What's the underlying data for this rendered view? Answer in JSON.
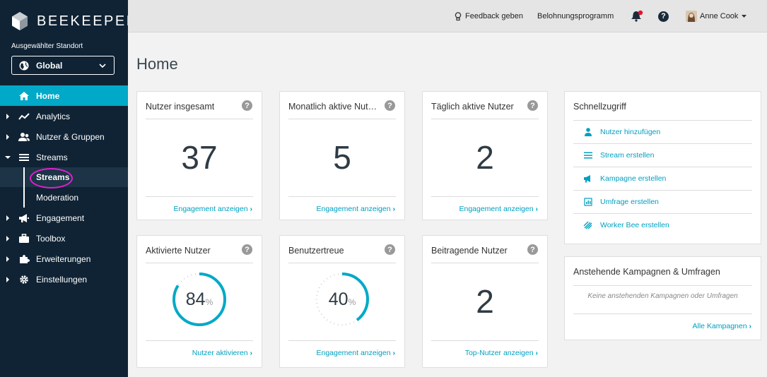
{
  "brand": {
    "name": "BEEKEEPER"
  },
  "location": {
    "label": "Ausgewählter Standort",
    "selected": "Global"
  },
  "nav": {
    "home": "Home",
    "analytics": "Analytics",
    "users": "Nutzer & Gruppen",
    "streams": "Streams",
    "streams_sub": "Streams",
    "moderation": "Moderation",
    "engagement": "Engagement",
    "toolbox": "Toolbox",
    "extensions": "Erweiterungen",
    "settings": "Einstellungen"
  },
  "topbar": {
    "feedback": "Feedback geben",
    "rewards": "Belohnungsprogramm",
    "help": "?",
    "user": "Anne Cook"
  },
  "page": {
    "title": "Home"
  },
  "cards": [
    {
      "title": "Nutzer insgesamt",
      "value": "37",
      "link": "Engagement anzeigen"
    },
    {
      "title": "Monatlich aktive Nutzer",
      "value": "5",
      "link": "Engagement anzeigen"
    },
    {
      "title": "Täglich aktive Nutzer",
      "value": "2",
      "link": "Engagement anzeigen"
    },
    {
      "title": "Aktivierte Nutzer",
      "value": "84",
      "unit": "%",
      "link": "Nutzer aktivieren",
      "percent": 84
    },
    {
      "title": "Benutzertreue",
      "value": "40",
      "unit": "%",
      "link": "Engagement anzeigen",
      "percent": 40
    },
    {
      "title": "Beitragende Nutzer",
      "value": "2",
      "link": "Top-Nutzer anzeigen"
    }
  ],
  "help_glyph": "?",
  "link_arrow": "›",
  "quick_access": {
    "title": "Schnellzugriff",
    "items": [
      {
        "label": "Nutzer hinzufügen",
        "icon": "person-icon"
      },
      {
        "label": "Stream erstellen",
        "icon": "list-icon"
      },
      {
        "label": "Kampagne erstellen",
        "icon": "megaphone-icon"
      },
      {
        "label": "Umfrage erstellen",
        "icon": "survey-icon"
      },
      {
        "label": "Worker Bee erstellen",
        "icon": "bee-icon"
      }
    ]
  },
  "pending": {
    "title": "Anstehende Kampagnen & Umfragen",
    "empty": "Keine anstehenden Kampagnen oder Umfragen",
    "link": "Alle Kampagnen"
  },
  "colors": {
    "accent": "#00a9c7",
    "sidebar": "#0f2335",
    "notification": "#e8112d"
  }
}
